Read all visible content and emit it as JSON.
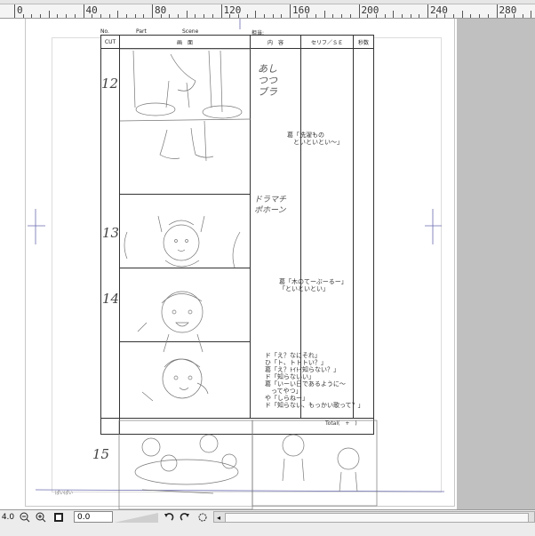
{
  "ruler": {
    "labels": [
      "0",
      "40",
      "80",
      "120",
      "160",
      "200",
      "240",
      "280"
    ]
  },
  "storyboard": {
    "header": {
      "no_label": "No.",
      "part_label": "Part",
      "scene_label": "Scene",
      "tantou_label": "担当:",
      "col_cut": "CUT",
      "col_picture": "画　面",
      "col_content": "内　容",
      "col_serif": "セリフ／ＳＥ",
      "col_seconds": "秒数"
    },
    "cut_numbers": [
      "12",
      "13",
      "14",
      "15"
    ],
    "notes": {
      "content_1": "あし\nつつ\nブラ",
      "content_2": "ドラマチ\nポホーン"
    },
    "dialogue": [
      "葛「洗濯もの\n　といといとい～」",
      "葛「木のてーぶーるー」\n「といといとい」",
      "ド「え？なにそれ」\nひ「ト、トトトい？」\n葛「え？ﾄｲﾄｲ知らない？」\nド「知らないい」\n葛「いーい日であるように～\n　ってやつ」\nや「しらねー」\nド「知らない、もっかい歌って？」"
    ],
    "total_label": "Total(　+　)",
    "footer_text": "ぱいぱい"
  },
  "bottom_bar": {
    "zoom_value": "4.0",
    "rotate_value": "0.0"
  },
  "colors": {
    "ruler_bg": "#f4f4f4",
    "workspace_gray": "#c0c0c0",
    "guide_blue": "#6a6ab0"
  }
}
